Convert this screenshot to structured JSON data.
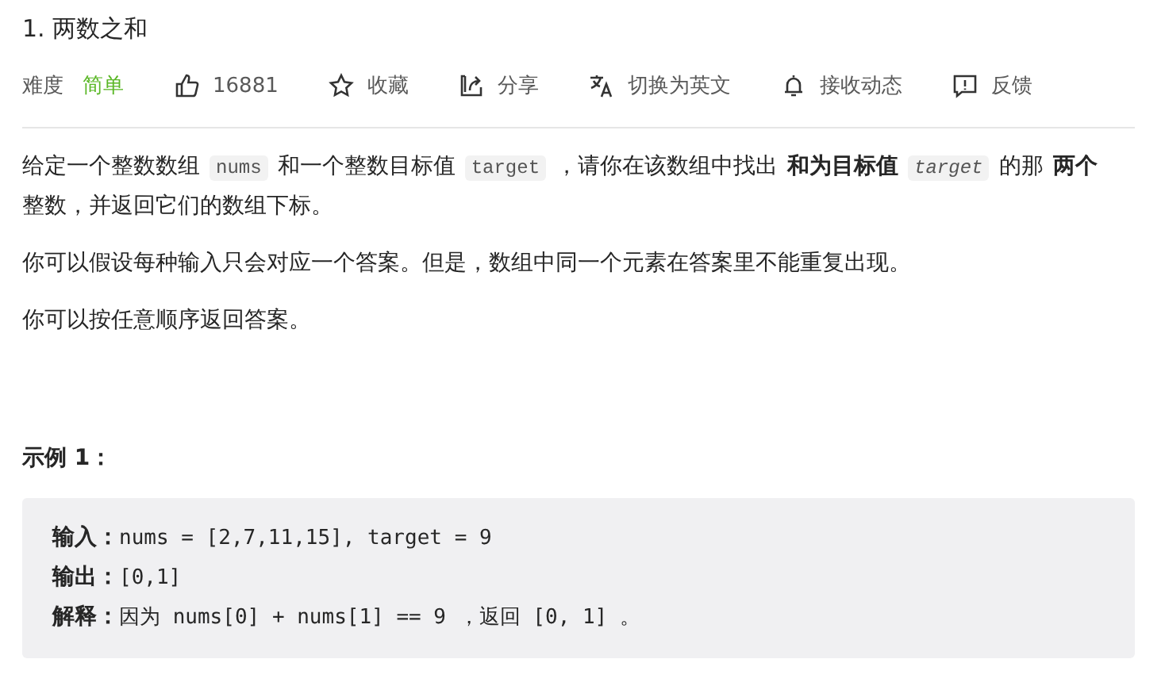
{
  "title": "1. 两数之和",
  "meta": {
    "difficulty_label": "难度",
    "difficulty": "简单",
    "actions": [
      {
        "kind": "like",
        "label": "16881"
      },
      {
        "kind": "star",
        "label": "收藏"
      },
      {
        "kind": "share",
        "label": "分享"
      },
      {
        "kind": "translate",
        "label": "切换为英文"
      },
      {
        "kind": "bell",
        "label": "接收动态"
      },
      {
        "kind": "feedback",
        "label": "反馈"
      }
    ]
  },
  "paragraphs": [
    [
      {
        "kind": "text",
        "text": "给定一个整数数组"
      },
      {
        "kind": "code",
        "text": "nums"
      },
      {
        "kind": "text",
        "text": "和一个整数目标值"
      },
      {
        "kind": "code",
        "text": "target"
      },
      {
        "kind": "text",
        "text": "，请你在该数组中找出"
      },
      {
        "kind": "bold",
        "text": "和为目标值"
      },
      {
        "kind": "code_italic",
        "text": "target"
      },
      {
        "kind": "text",
        "text": "的那"
      },
      {
        "kind": "bold",
        "text": "两个"
      },
      {
        "kind": "text",
        "text": "整数，并返回它们的数组下标。"
      }
    ],
    [
      {
        "kind": "text",
        "text": "你可以假设每种输入只会对应一个答案。但是，数组中同一个元素在答案里不能重复出现。"
      }
    ],
    [
      {
        "kind": "text",
        "text": "你可以按任意顺序返回答案。"
      }
    ]
  ],
  "example": {
    "title": "示例 1：",
    "lines": [
      {
        "label": "输入：",
        "value": "nums = [2,7,11,15], target = 9"
      },
      {
        "label": "输出：",
        "value": "[0,1]"
      },
      {
        "label": "解释：",
        "value": "因为 nums[0] + nums[1] == 9 ，返回 [0, 1] 。"
      }
    ]
  }
}
